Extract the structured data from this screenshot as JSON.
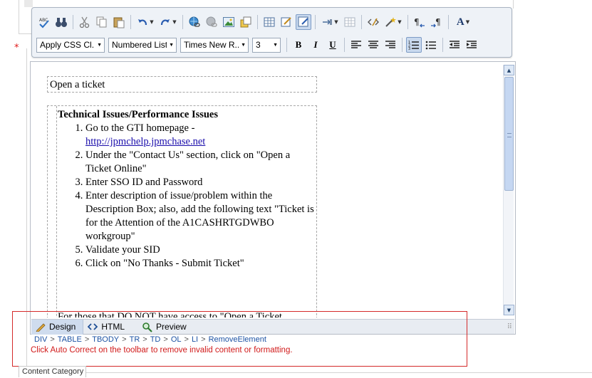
{
  "required_marker": "*",
  "toolbar": {
    "dropdowns": {
      "css_class": "Apply CSS Cl...",
      "paragraph_style": "Numbered List",
      "font_name": "Times New R...",
      "font_size": "3"
    },
    "format": {
      "bold": "B",
      "italic": "I",
      "underline": "U"
    },
    "font_color_letter": "A"
  },
  "editor": {
    "title_cell": "Open a ticket",
    "section_heading": "Technical Issues/Performance Issues",
    "steps": {
      "s1_text": "Go to the GTI homepage -",
      "s1_link": "http://jpmchelp.jpmchase.net",
      "s2": "Under the \"Contact Us\" section, click on \"Open a Ticket Online\"",
      "s3": "Enter SSO ID and Password",
      "s4": "Enter description of issue/problem within the Description Box; also, add the following text \"Ticket is for the Attention of the A1CASHRTGDWBO workgroup\"",
      "s5": "Validate your SID",
      "s6": "Click on \"No Thanks - Submit Ticket\""
    },
    "cut_off_line": "For those that DO NOT have access to \"Open a Ticket"
  },
  "modes": {
    "design": "Design",
    "html": "HTML",
    "preview": "Preview"
  },
  "path": [
    "DIV",
    "TABLE",
    "TBODY",
    "TR",
    "TD",
    "OL",
    "LI",
    "RemoveElement"
  ],
  "path_separator": ">",
  "warning": "Click Auto Correct on the toolbar to remove invalid content or formatting.",
  "content_category_tab": "Content Category",
  "colors": {
    "warning": "#d11a1a",
    "path_link": "#1c52a3",
    "highlight_box": "#d42a2a"
  }
}
